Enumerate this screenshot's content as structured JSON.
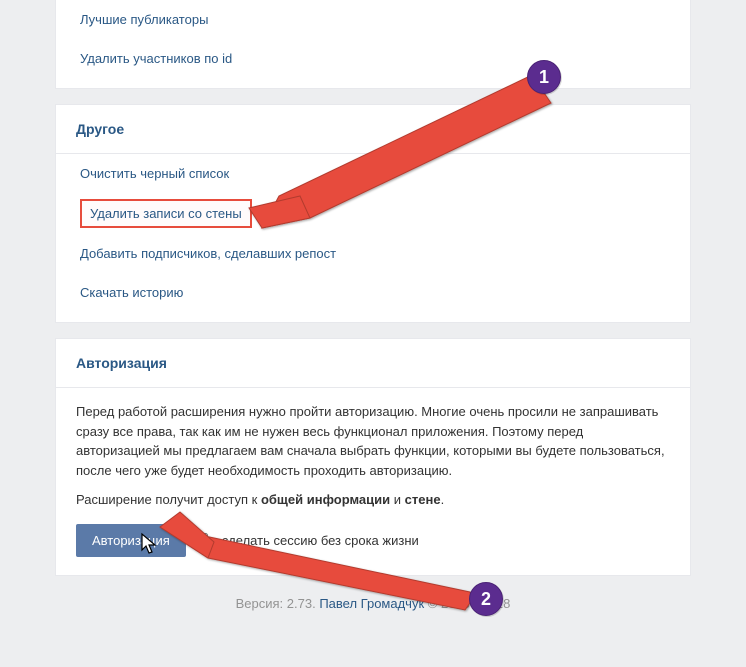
{
  "top_links": [
    "Лучшие публикаторы",
    "Удалить участников по id"
  ],
  "other": {
    "header": "Другое",
    "items": [
      "Очистить черный список",
      "Удалить записи со стены",
      "Добавить подписчиков, сделавших репост",
      "Скачать историю"
    ],
    "highlight_index": 1
  },
  "auth": {
    "header": "Авторизация",
    "paragraph": "Перед работой расширения нужно пройти авторизацию. Многие очень просили не запрашивать сразу все права, так как им не нужен весь функционал приложения. Поэтому перед авторизацией мы предлагаем вам сначала выбрать функции, которыми вы будете пользоваться, после чего уже будет необходимость проходить авторизацию.",
    "permissions_prefix": "Расширение получит доступ к ",
    "perm1": "общей информации",
    "perm_and": " и ",
    "perm2": "стене",
    "perm_suffix": ".",
    "button": "Авторизация",
    "checkbox_label": "- сделать сессию без срока жизни"
  },
  "footer": {
    "version_prefix": "Версия: 2.73.",
    "author": "Павел Громадчук",
    "copyright": " © 2016 - 2018"
  },
  "annotations": {
    "badge1": "1",
    "badge2": "2"
  }
}
